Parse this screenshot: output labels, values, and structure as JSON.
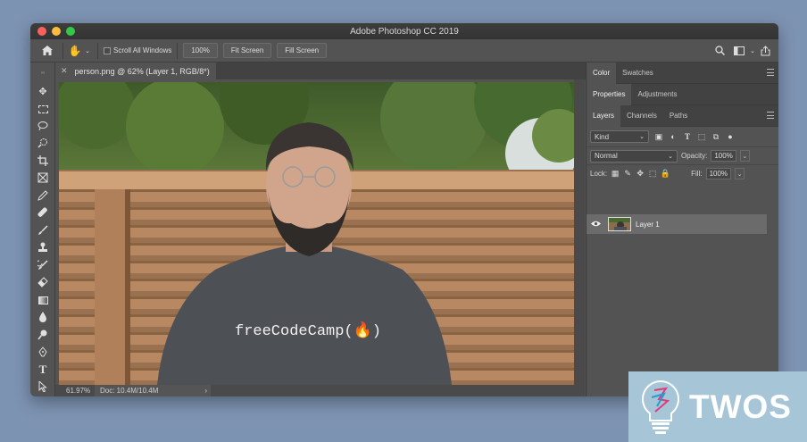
{
  "app": {
    "window_title": "Adobe Photoshop CC 2019"
  },
  "options_bar": {
    "scroll_all_windows": "Scroll All Windows",
    "zoom_100": "100%",
    "fit_screen": "Fit Screen",
    "fill_screen": "Fill Screen"
  },
  "document": {
    "tab_title": "person.png @ 62% (Layer 1, RGB/8*)",
    "shirt_text": "freeCodeCamp(🔥)"
  },
  "status": {
    "zoom": "61.97%",
    "doc_size": "Doc: 10.4M/10.4M",
    "arrow": "›"
  },
  "panels": {
    "top_tabs": [
      "Color",
      "Swatches"
    ],
    "mid_tabs": [
      "Properties",
      "Adjustments"
    ],
    "layer_tabs": [
      "Layers",
      "Channels",
      "Paths"
    ],
    "filter_kind": "Kind",
    "blend_mode": "Normal",
    "opacity_label": "Opacity:",
    "opacity_value": "100%",
    "lock_label": "Lock:",
    "fill_label": "Fill:",
    "fill_value": "100%",
    "layer_name": "Layer 1"
  },
  "watermark": {
    "text": "TWOS"
  },
  "icons": [
    "home-icon",
    "hand-icon",
    "search-icon",
    "workspace-icon",
    "share-icon",
    "move-icon",
    "marquee-icon",
    "lasso-icon",
    "quick-select-icon",
    "crop-icon",
    "frame-icon",
    "eyedropper-icon",
    "healing-icon",
    "brush-icon",
    "stamp-icon",
    "history-brush-icon",
    "eraser-icon",
    "gradient-icon",
    "blur-icon",
    "dodge-icon",
    "pen-icon",
    "type-icon",
    "path-select-icon",
    "eye-icon"
  ]
}
